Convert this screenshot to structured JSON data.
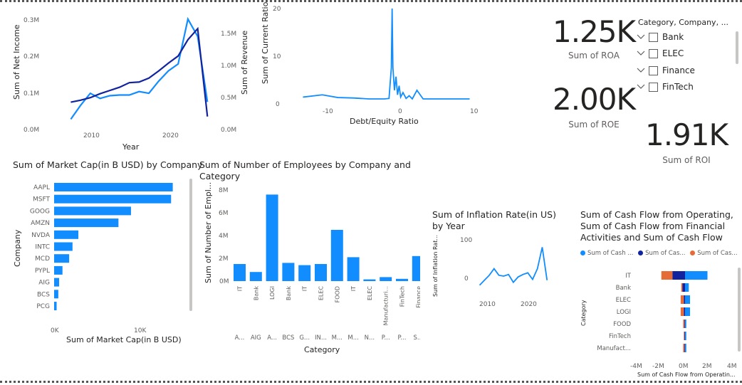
{
  "colors": {
    "light_blue": "#118DFF",
    "dark_blue": "#12239E",
    "orange": "#E66C37",
    "text": "#252423",
    "muted": "#605e5c"
  },
  "line_chart": {
    "y_title": "Sum of Net Income",
    "y2_title": "Sum of Revenue",
    "x_title": "Year",
    "y_ticks": [
      "0.0M",
      "0.1M",
      "0.2M",
      "0.3M"
    ],
    "y2_ticks": [
      "0.0M",
      "0.5M",
      "1.0M",
      "1.5M"
    ],
    "x_ticks": [
      "2010",
      "2020"
    ]
  },
  "scatter_line": {
    "y_title": "Sum of Current Ratio",
    "x_title": "Debt/Equity Ratio",
    "y_ticks": [
      "0",
      "10",
      "20"
    ],
    "x_ticks": [
      "-10",
      "0",
      "10"
    ]
  },
  "kpis": {
    "roa_value": "1.25K",
    "roa_label": "Sum of ROA",
    "roe_value": "2.00K",
    "roe_label": "Sum of ROE",
    "roi_value": "1.91K",
    "roi_label": "Sum of ROI"
  },
  "slicer": {
    "header": "Category, Company, ...",
    "items": [
      "Bank",
      "ELEC",
      "Finance",
      "FinTech"
    ]
  },
  "market_cap": {
    "title": "Sum of Market Cap(in B USD) by Company",
    "x_title": "Sum of Market Cap(in B USD)",
    "y_title": "Company",
    "x_ticks": [
      "0K",
      "10K"
    ]
  },
  "employees": {
    "title": "Sum of Number of Employees by Company and Category",
    "y_title": "Sum of Number of Empl...",
    "x_title": "Category",
    "y_ticks": [
      "0M",
      "2M",
      "4M",
      "6M",
      "8M"
    ],
    "group_labels": [
      "A...",
      "AIG",
      "A...",
      "BCS",
      "G...",
      "IN...",
      "M...",
      "M...",
      "N...",
      "P...",
      "P...",
      "S..."
    ]
  },
  "inflation": {
    "title": "Sum of Inflation Rate(in US) by Year",
    "y_title": "Sum of Inflation Rat...",
    "y_ticks": [
      "0",
      "100"
    ],
    "x_ticks": [
      "2010",
      "2020"
    ]
  },
  "cashflow": {
    "title": "Sum of Cash Flow from Operating, Sum of Cash Flow from Financial Activities and Sum of Cash Flow fro...",
    "legend": [
      "Sum of Cash ...",
      "Sum of Cas...",
      "Sum of Cas..."
    ],
    "y_title": "Category",
    "x_title": "Sum of Cash Flow from Operatin...",
    "x_ticks": [
      "-4M",
      "-2M",
      "0M",
      "2M",
      "4M"
    ]
  },
  "chart_data": [
    {
      "type": "line",
      "x": [
        2009,
        2010,
        2011,
        2012,
        2013,
        2014,
        2015,
        2016,
        2017,
        2018,
        2019,
        2020,
        2021,
        2022,
        2023
      ],
      "series": [
        {
          "name": "Sum of Net Income",
          "axis": "left",
          "color": "#118DFF",
          "values": [
            0.03,
            0.07,
            0.105,
            0.09,
            0.098,
            0.1,
            0.1,
            0.11,
            0.105,
            0.14,
            0.17,
            0.19,
            0.32,
            0.27,
            0.08
          ]
        },
        {
          "name": "Sum of Revenue",
          "axis": "right",
          "color": "#12239E",
          "values": [
            0.42,
            0.45,
            0.49,
            0.55,
            0.6,
            0.65,
            0.72,
            0.73,
            0.79,
            0.9,
            1.02,
            1.13,
            1.38,
            1.55,
            0.2
          ]
        }
      ],
      "ylim": [
        0,
        0.33
      ],
      "y2lim": [
        0,
        1.75
      ],
      "xlim": [
        2007,
        2024
      ],
      "xlabel": "Year",
      "ylabel": "Sum of Net Income",
      "y2label": "Sum of Revenue"
    },
    {
      "type": "line",
      "x": [
        -11.5,
        -9,
        -7,
        -5,
        -3,
        -1,
        -0.4,
        -0.1,
        0,
        0.1,
        0.3,
        0.5,
        0.7,
        0.9,
        1.1,
        1.4,
        1.8,
        2.2,
        2.6,
        3.2,
        4,
        6,
        10
      ],
      "series": [
        {
          "name": "Sum of Current Ratio",
          "color": "#118DFF",
          "values": [
            1.5,
            2,
            1.4,
            1.3,
            1.1,
            1.1,
            1.2,
            8,
            21,
            8,
            3,
            6,
            2,
            4,
            1.5,
            2.5,
            1.2,
            1.8,
            1.1,
            3,
            1.1,
            1.1,
            1.1
          ]
        }
      ],
      "ylim": [
        0,
        21
      ],
      "xlim": [
        -12,
        10.5
      ],
      "xlabel": "Debt/Equity Ratio",
      "ylabel": "Sum of Current Ratio"
    },
    {
      "type": "bar",
      "orientation": "horizontal",
      "categories": [
        "AAPL",
        "MSFT",
        "GOOG",
        "AMZN",
        "NVDA",
        "INTC",
        "MCD",
        "PYPL",
        "AIG",
        "BCS",
        "PCG"
      ],
      "values": [
        14200,
        14000,
        9200,
        7700,
        2900,
        2200,
        1800,
        1000,
        600,
        500,
        300
      ],
      "xlim": [
        0,
        15000
      ],
      "title": "Sum of Market Cap(in B USD) by Company",
      "xlabel": "Sum of Market Cap(in B USD)",
      "ylabel": "Company"
    },
    {
      "type": "bar",
      "categories": [
        "IT",
        "Bank",
        "LOGI",
        "Bank",
        "IT",
        "ELEC",
        "FOOD",
        "IT",
        "ELEC",
        "Manufacturi...",
        "FinTech",
        "Finance"
      ],
      "values": [
        1500000,
        800000,
        7600000,
        1600000,
        1400000,
        1500000,
        4500000,
        2100000,
        150000,
        350000,
        200000,
        2200000
      ],
      "ylim": [
        0,
        8000000
      ],
      "title": "Sum of Number of Employees by Company and Category",
      "xlabel": "Category",
      "ylabel": "Sum of Number of Empl..."
    },
    {
      "type": "line",
      "x": [
        2009,
        2010,
        2011,
        2012,
        2013,
        2014,
        2015,
        2016,
        2017,
        2018,
        2019,
        2020,
        2021,
        2022,
        2023
      ],
      "series": [
        {
          "name": "Sum of Inflation Rate(in US)",
          "color": "#118DFF",
          "values": [
            -2,
            10,
            22,
            38,
            22,
            20,
            24,
            5,
            18,
            24,
            28,
            12,
            38,
            90,
            10
          ]
        }
      ],
      "ylim": [
        -30,
        120
      ],
      "xlim": [
        2007,
        2024
      ],
      "title": "Sum of Inflation Rate(in US) by Year"
    },
    {
      "type": "bar",
      "orientation": "horizontal",
      "stacked": true,
      "categories": [
        "IT",
        "Bank",
        "ELEC",
        "LOGI",
        "FOOD",
        "FinTech",
        "Manufact..."
      ],
      "series": [
        {
          "name": "Sum of Cash ...",
          "color": "#118DFF",
          "values": [
            1800000,
            300000,
            400000,
            400000,
            100000,
            100000,
            100000
          ]
        },
        {
          "name": "Sum of Cas...",
          "color": "#12239E",
          "values": [
            -1000000,
            -200000,
            -100000,
            -100000,
            -50000,
            -50000,
            -50000
          ]
        },
        {
          "name": "Sum of Cas...",
          "color": "#E66C37",
          "values": [
            -900000,
            -100000,
            -250000,
            -250000,
            -100000,
            -50000,
            -100000
          ]
        }
      ],
      "xlim": [
        -4000000,
        4000000
      ],
      "xlabel": "Sum of Cash Flow from Operatin...",
      "ylabel": "Category"
    }
  ]
}
